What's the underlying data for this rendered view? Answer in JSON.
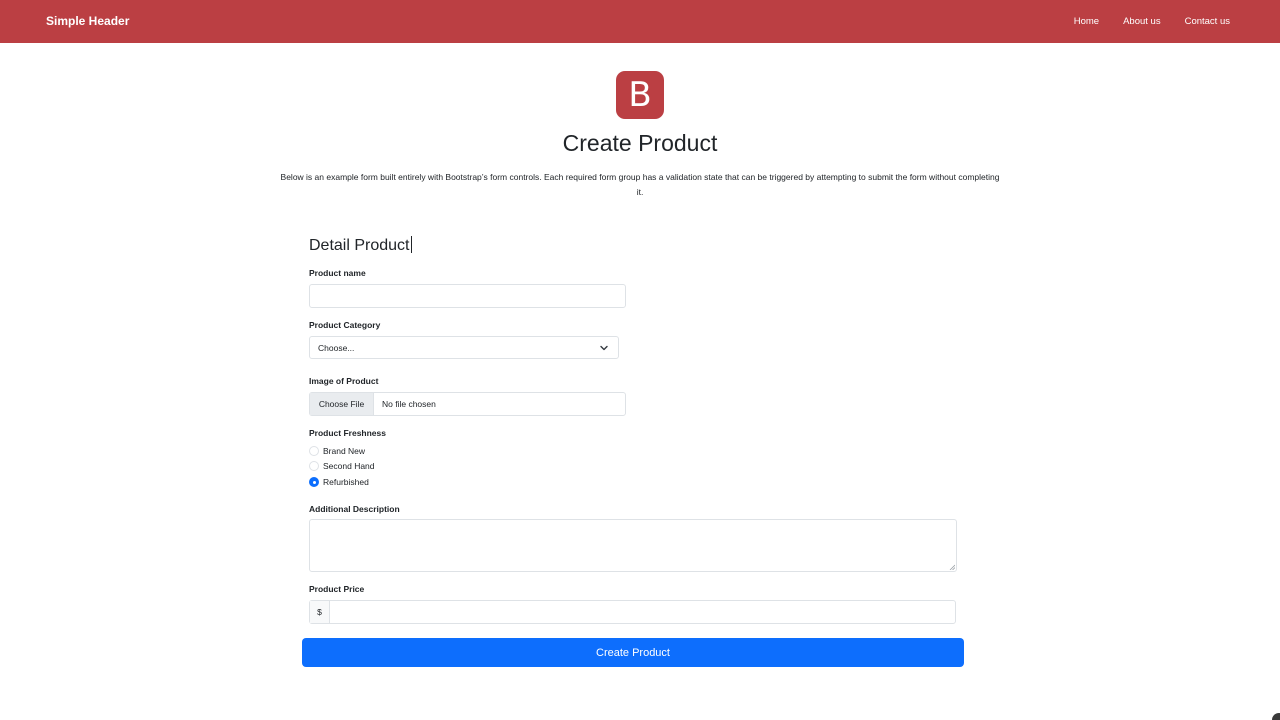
{
  "header": {
    "brand": "Simple Header",
    "nav": [
      "Home",
      "About us",
      "Contact us"
    ]
  },
  "logo": {
    "letter": "B"
  },
  "page": {
    "title": "Create Product",
    "lead": "Below is an example form built entirely with Bootstrap’s form controls. Each required form group has a validation state that can be triggered by attempting to submit the form without completing it."
  },
  "form": {
    "section_title": "Detail Product",
    "product_name": {
      "label": "Product name",
      "value": ""
    },
    "category": {
      "label": "Product Category",
      "selected": "Choose..."
    },
    "image": {
      "label": "Image of Product",
      "button": "Choose File",
      "status": "No file chosen"
    },
    "freshness": {
      "label": "Product Freshness",
      "options": [
        "Brand New",
        "Second Hand",
        "Refurbished"
      ],
      "selected": "Refurbished"
    },
    "description": {
      "label": "Additional Description",
      "value": ""
    },
    "price": {
      "label": "Product Price",
      "prefix": "$",
      "value": ""
    },
    "submit": "Create Product"
  },
  "colors": {
    "brand": "#bb3f43",
    "primary": "#0d6efd",
    "border": "#dee2e6"
  }
}
